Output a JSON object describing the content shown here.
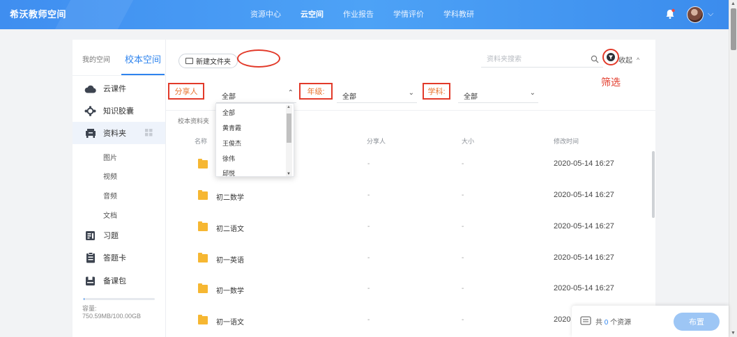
{
  "header": {
    "brand": "希沃教师空间",
    "nav": [
      "资源中心",
      "云空间",
      "作业报告",
      "学情评价",
      "学科教研"
    ],
    "active_nav": "云空间"
  },
  "sidebar": {
    "tabs": [
      "我的空间",
      "校本空间"
    ],
    "active_tab": "校本空间",
    "items": [
      {
        "label": "云课件",
        "icon": "cloud-icon"
      },
      {
        "label": "知识胶囊",
        "icon": "capsule-icon"
      },
      {
        "label": "资料夹",
        "icon": "folder-stack-icon"
      },
      {
        "label": "习题",
        "icon": "exercise-icon"
      },
      {
        "label": "答题卡",
        "icon": "answer-card-icon"
      },
      {
        "label": "备课包",
        "icon": "lesson-pack-icon"
      }
    ],
    "subitems": [
      "图片",
      "视频",
      "音频",
      "文档"
    ],
    "capacity_label": "容量:",
    "capacity_value": "750.59MB/100.00GB",
    "capacity_fraction": 0.0073
  },
  "toolbar": {
    "new_folder": "新建文件夹",
    "search_placeholder": "资料夹搜索",
    "collapse": "收起",
    "annotation": "筛选"
  },
  "filters": {
    "sharer_label": "分享人",
    "sharer_value": "全部",
    "grade_label": "年级:",
    "grade_value": "全部",
    "subject_label": "学科:",
    "subject_value": "全部"
  },
  "dropdown": {
    "options": [
      "全部",
      "黄青霞",
      "王俊杰",
      "徐伟",
      "邱悦"
    ]
  },
  "breadcrumb": "校本资料夹",
  "table": {
    "headers": [
      "名称",
      "分享人",
      "大小",
      "修改时间"
    ],
    "rows": [
      {
        "name": "",
        "sharer": "-",
        "size": "-",
        "time": "2020-05-14 16:27"
      },
      {
        "name": "初二数学",
        "sharer": "-",
        "size": "-",
        "time": "2020-05-14 16:27"
      },
      {
        "name": "初二语文",
        "sharer": "-",
        "size": "-",
        "time": "2020-05-14 16:27"
      },
      {
        "name": "初一英语",
        "sharer": "-",
        "size": "-",
        "time": "2020-05-14 16:27"
      },
      {
        "name": "初一数学",
        "sharer": "-",
        "size": "-",
        "time": "2020-05-14 16:27"
      },
      {
        "name": "初一语文",
        "sharer": "-",
        "size": "-",
        "time": "2020"
      }
    ]
  },
  "bottom": {
    "total_prefix": "共",
    "total_count": "0",
    "total_suffix": "个资源",
    "arrange": "布置"
  },
  "colors": {
    "accent": "#2f84ee",
    "annotation": "#e23a2a",
    "folder": "#f6b732"
  }
}
